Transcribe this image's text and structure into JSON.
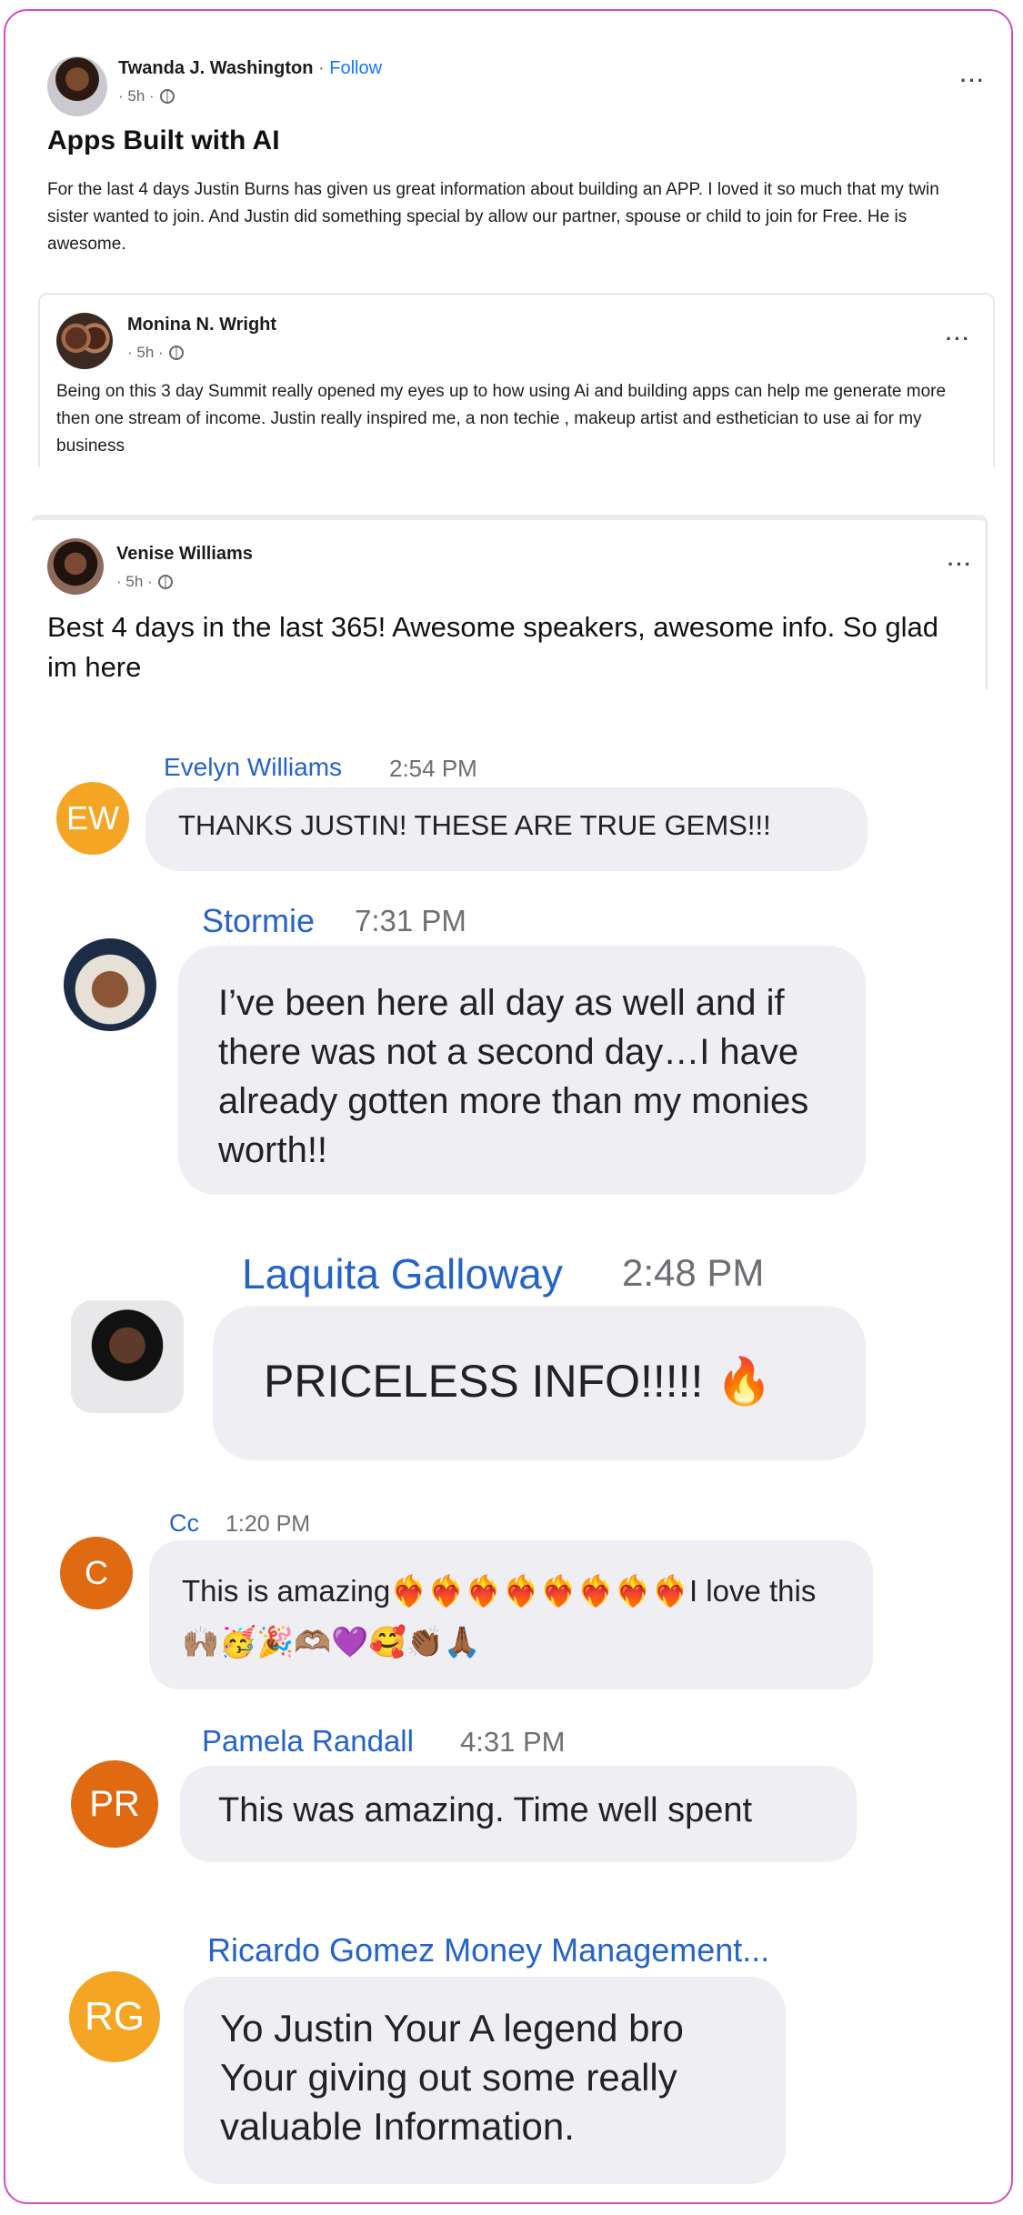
{
  "posts": [
    {
      "author": "Twanda J. Washington",
      "separator": "·",
      "follow_label": "Follow",
      "time": "· 5h ·",
      "title": "Apps Built with AI",
      "body": "For the last 4 days Justin Burns has given us great information about building an APP. I loved it so much that my twin sister wanted to join. And Justin did something special by allow our partner, spouse or child to join for Free. He is awesome.",
      "more_icon": "more-dots-icon"
    },
    {
      "author": "Monina N. Wright",
      "time": "· 5h ·",
      "body": "Being on this 3 day Summit really opened my eyes up to how using Ai and building apps can help me generate more then one stream of income. Justin really inspired me, a non techie , makeup artist and esthetician to use ai for my business",
      "more_icon": "more-dots-icon"
    },
    {
      "author": "Venise Williams",
      "time": "· 5h ·",
      "body": "Best 4 days in the last 365! Awesome speakers, awesome info. So glad im here",
      "more_icon": "more-dots-icon"
    }
  ],
  "chat": [
    {
      "name": "Evelyn Williams",
      "time": "2:54 PM",
      "initials": "EW",
      "avatar_color": "#f5a524",
      "message": "THANKS JUSTIN! THESE ARE TRUE GEMS!!!"
    },
    {
      "name": "Stormie",
      "time": "7:31 PM",
      "message": "I’ve been here all day as well and if there was not a second day…I have already gotten more than my monies worth!!"
    },
    {
      "name": "Laquita Galloway",
      "time": "2:48 PM",
      "message": "PRICELESS INFO!!!!! 🔥"
    },
    {
      "name": "Cc",
      "time": "1:20 PM",
      "initials": "C",
      "avatar_color": "#e06a12",
      "message": "This is amazing❤️‍🔥❤️‍🔥❤️‍🔥❤️‍🔥❤️‍🔥❤️‍🔥❤️‍🔥❤️‍🔥I love this 🙌🏽🥳🎉🫶🏽💜🥰👏🏾🙏🏾"
    },
    {
      "name": "Pamela Randall",
      "time": "4:31 PM",
      "initials": "PR",
      "avatar_color": "#e06a12",
      "message": "This was amazing. Time well spent"
    },
    {
      "name": "Ricardo Gomez Money Management...",
      "initials": "RG",
      "avatar_color": "#f5a524",
      "message": "Yo Justin Your A legend bro Your giving out some really valuable Information."
    }
  ],
  "colors": {
    "frame_border": "#d14fbf",
    "link_blue": "#2563c9",
    "bubble_bg": "#eeeef3"
  }
}
